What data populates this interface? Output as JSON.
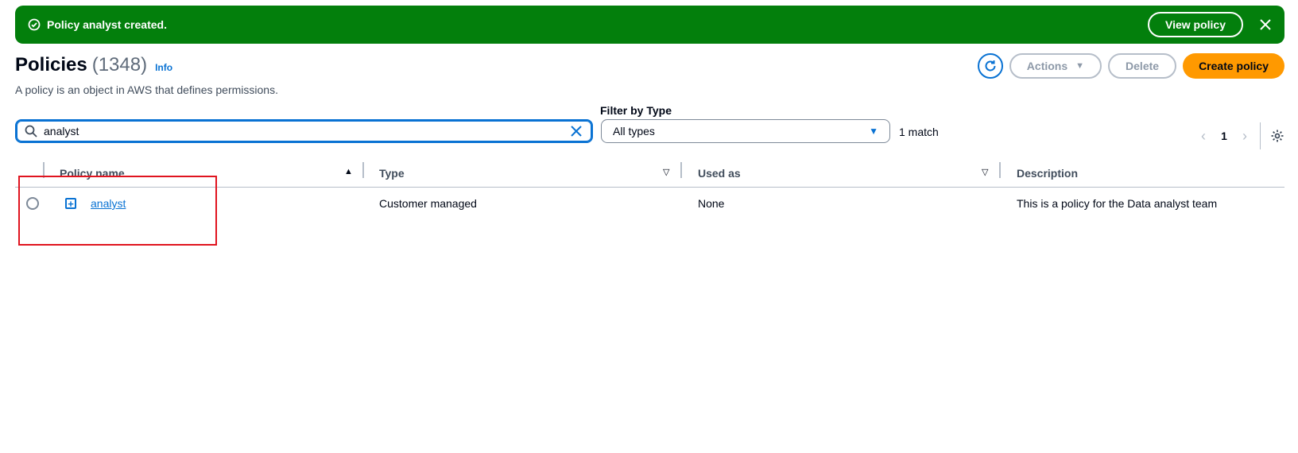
{
  "flash": {
    "message": "Policy analyst created.",
    "view_button": "View policy",
    "bg_color": "#037f0c"
  },
  "header": {
    "title": "Policies",
    "count": "(1348)",
    "info": "Info",
    "description": "A policy is an object in AWS that defines permissions.",
    "actions_label": "Actions",
    "delete_label": "Delete",
    "create_label": "Create policy",
    "accent_color": "#ff9900"
  },
  "filters": {
    "search_value": "analyst",
    "type_label": "Filter by Type",
    "type_value": "All types",
    "match_count": "1 match"
  },
  "pagination": {
    "current_page": "1"
  },
  "table": {
    "columns": [
      "Policy name",
      "Type",
      "Used as",
      "Description"
    ],
    "rows": [
      {
        "name": "analyst",
        "type": "Customer managed",
        "used_as": "None",
        "description": "This is a policy for the Data analyst team"
      }
    ]
  }
}
